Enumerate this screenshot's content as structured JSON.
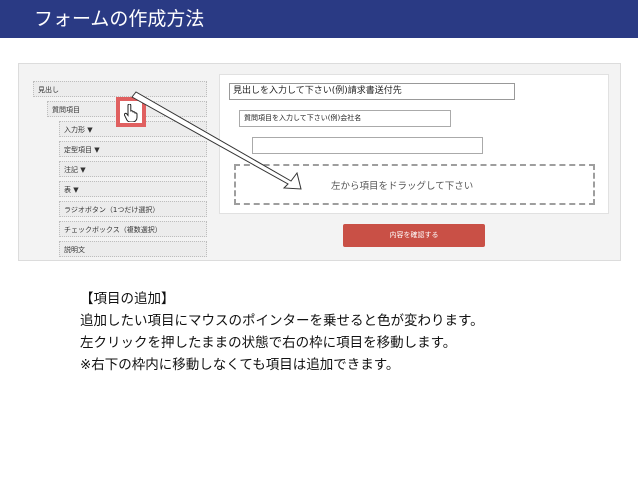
{
  "header": {
    "title": "フォームの作成方法"
  },
  "tree": {
    "items": [
      {
        "label": "見出し"
      },
      {
        "label": "質問項目"
      },
      {
        "label": "入力形 ▼"
      },
      {
        "label": "定型項目 ▼"
      },
      {
        "label": "注記 ▼"
      },
      {
        "label": "表 ▼"
      },
      {
        "label": "ラジオボタン（1つだけ選択）"
      },
      {
        "label": "チェックボックス（複数選択）"
      },
      {
        "label": "説明文"
      }
    ]
  },
  "form": {
    "title_placeholder": "見出しを入力して下さい(例)請求書送付先",
    "question_placeholder": "質問項目を入力して下さい(例)会社名",
    "drop_zone_label": "左から項目をドラッグして下さい",
    "confirm_label": "内容を確認する"
  },
  "description": {
    "heading": "【項目の追加】",
    "lines": [
      "追加したい項目にマウスのポインターを乗せると色が変わります。",
      "左クリックを押したままの状態で右の枠に項目を移動します。",
      "※右下の枠内に移動しなくても項目は追加できます。"
    ]
  },
  "colors": {
    "header_bg": "#2a3a84",
    "highlight_border": "#e06060",
    "confirm_button": "#c95046"
  },
  "icons": {
    "pointer": "hand-pointer-icon",
    "drag_arrow": "arrow-icon"
  }
}
